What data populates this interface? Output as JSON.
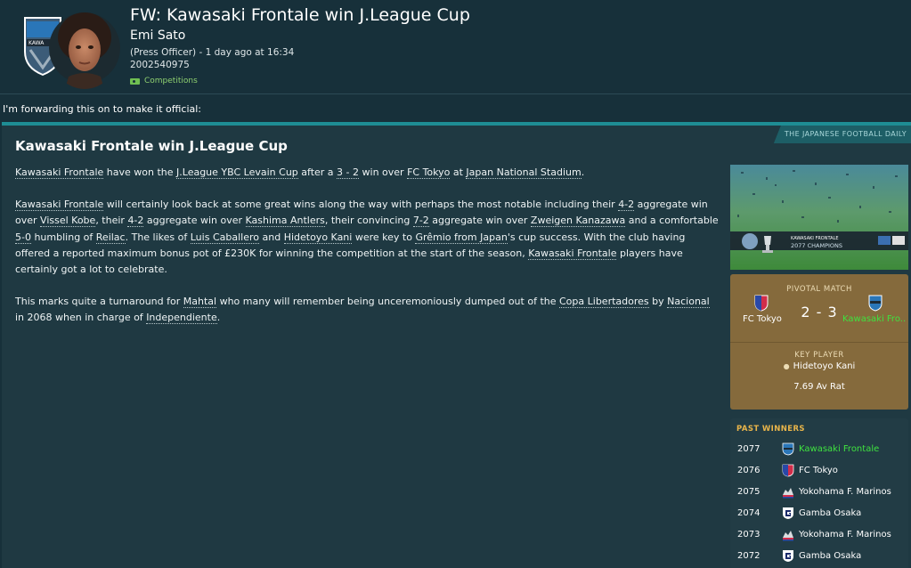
{
  "header": {
    "title": "FW: Kawasaki Frontale win J.League Cup",
    "sender": "Emi Sato",
    "meta": "(Press Officer) - 1 day ago at 16:34",
    "id": "2002540975",
    "tag": "Competitions"
  },
  "forward_note": "I'm forwarding this on to make it official:",
  "article": {
    "paper": "THE JAPANESE FOOTBALL DAILY",
    "headline": "Kawasaki Frontale win J.League Cup",
    "p1": {
      "t1": "Kawasaki Frontale",
      "t2": " have won the ",
      "t3": "J.League YBC Levain Cup",
      "t4": " after a ",
      "t5": "3 - 2",
      "t6": " win over ",
      "t7": "FC Tokyo",
      "t8": " at ",
      "t9": "Japan National Stadium",
      "t10": "."
    },
    "p2": {
      "t1": "Kawasaki Frontale",
      "t2": " will certainly look back at some great wins along the way with perhaps the most notable including their ",
      "t3": "4-2",
      "t4": " aggregate win over ",
      "t5": "Vissel Kobe",
      "t6": ", their ",
      "t7": "4-2",
      "t8": " aggregate win over ",
      "t9": "Kashima Antlers",
      "t10": ", their convincing ",
      "t11": "7-2",
      "t12": " aggregate win over ",
      "t13": "Zweigen Kanazawa",
      "t14": " and a comfortable ",
      "t15": "5-0",
      "t16": " humbling of ",
      "t17": "Reilac",
      "t18": ". The likes of ",
      "t19": "Luis Caballero",
      "t20": " and ",
      "t21": "Hidetoyo Kani",
      "t22": " were key to ",
      "t23": "Grêmio from Japan",
      "t24": "'s cup success. With the club having offered a reported maximum bonus pot of £230K for winning the competition at the start of the season, ",
      "t25": "Kawasaki Frontale",
      "t26": " players have certainly got a lot to celebrate."
    },
    "p3": {
      "t1": "This marks quite a turnaround for ",
      "t2": "Mahtal",
      "t3": " who many will remember being unceremoniously dumped out of the ",
      "t4": "Copa Libertadores",
      "t5": " by ",
      "t6": "Nacional",
      "t7": " in 2068 when in charge of ",
      "t8": "Independiente",
      "t9": "."
    }
  },
  "photo": {
    "banner_club": "KAWASAKI FRONTALE",
    "banner_title": "2077 CHAMPIONS"
  },
  "pivotal_match": {
    "title": "PIVOTAL MATCH",
    "home": "FC Tokyo",
    "away": "Kawasaki Fro...",
    "score": "2 - 3",
    "key_player_title": "KEY PLAYER",
    "key_player": "Hidetoyo Kani",
    "rating": "7.69 Av Rat"
  },
  "past_winners": {
    "title": "PAST WINNERS",
    "rows": [
      {
        "year": "2077",
        "team": "Kawasaki Frontale",
        "badge": "kawasaki-badge-icon"
      },
      {
        "year": "2076",
        "team": "FC Tokyo",
        "badge": "fc-tokyo-badge-icon"
      },
      {
        "year": "2075",
        "team": "Yokohama F. Marinos",
        "badge": "yokohama-badge-icon"
      },
      {
        "year": "2074",
        "team": "Gamba Osaka",
        "badge": "gamba-badge-icon"
      },
      {
        "year": "2073",
        "team": "Yokohama F. Marinos",
        "badge": "yokohama-badge-icon"
      },
      {
        "year": "2072",
        "team": "Gamba Osaka",
        "badge": "gamba-badge-icon"
      }
    ]
  },
  "colors": {
    "background": "#17303a",
    "accent_teal": "#1e8d94",
    "pivotal_bg": "#856a3c",
    "winner_green": "#3fe23f",
    "title_gold": "#e9b54a"
  }
}
